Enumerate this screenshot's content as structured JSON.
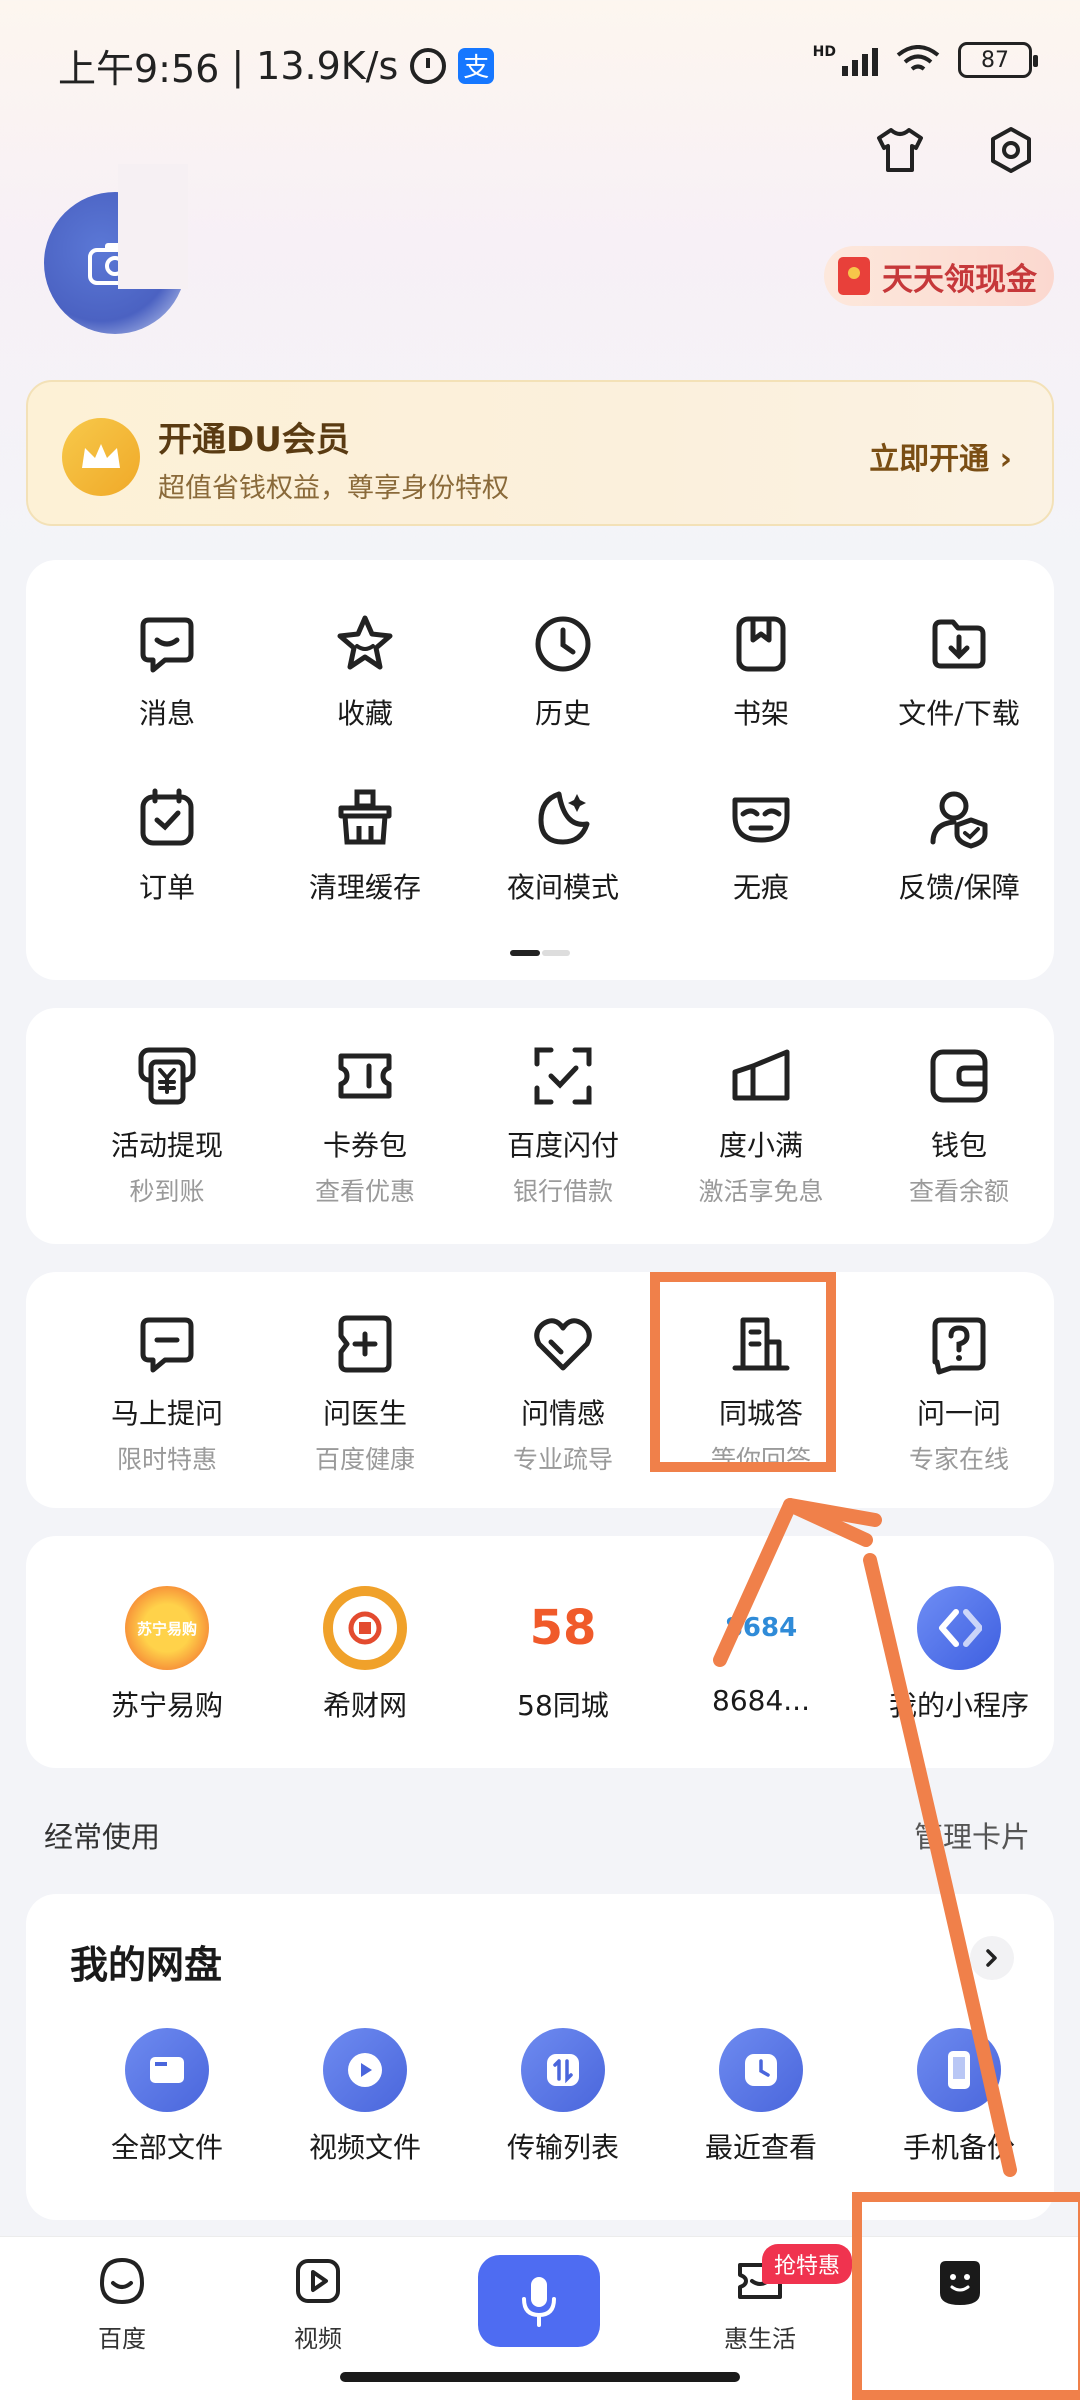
{
  "status_bar": {
    "time": "上午9:56",
    "speed": "13.9K/s",
    "battery": "87",
    "network": "HD",
    "alipay_glyph": "支"
  },
  "header": {
    "icons": [
      "shirt-icon",
      "gear-icon"
    ],
    "cash_pill_label": "天天领现金"
  },
  "vip": {
    "title": "开通DU会员",
    "subtitle": "超值省钱权益，尊享身份特权",
    "action": "立即开通 ›"
  },
  "quick_tools": [
    {
      "label": "消息",
      "icon": "message-icon"
    },
    {
      "label": "收藏",
      "icon": "star-icon"
    },
    {
      "label": "历史",
      "icon": "clock-icon"
    },
    {
      "label": "书架",
      "icon": "bookmark-icon"
    },
    {
      "label": "文件/下载",
      "icon": "download-icon"
    },
    {
      "label": "订单",
      "icon": "order-icon"
    },
    {
      "label": "清理缓存",
      "icon": "clean-icon"
    },
    {
      "label": "夜间模式",
      "icon": "moon-icon"
    },
    {
      "label": "无痕",
      "icon": "mask-icon"
    },
    {
      "label": "反馈/保障",
      "icon": "feedback-icon"
    }
  ],
  "finance": [
    {
      "label": "活动提现",
      "sub": "秒到账",
      "icon": "yuan-icon"
    },
    {
      "label": "卡券包",
      "sub": "查看优惠",
      "icon": "ticket-icon"
    },
    {
      "label": "百度闪付",
      "sub": "银行借款",
      "icon": "scan-check-icon"
    },
    {
      "label": "度小满",
      "sub": "激活享免息",
      "icon": "duxiaoman-icon"
    },
    {
      "label": "钱包",
      "sub": "查看余额",
      "icon": "wallet-icon"
    }
  ],
  "ask": [
    {
      "label": "马上提问",
      "sub": "限时特惠",
      "icon": "ask-icon"
    },
    {
      "label": "问医生",
      "sub": "百度健康",
      "icon": "doctor-icon"
    },
    {
      "label": "问情感",
      "sub": "专业疏导",
      "icon": "heart-icon"
    },
    {
      "label": "同城答",
      "sub": "等你回答",
      "icon": "building-icon"
    },
    {
      "label": "问一问",
      "sub": "专家在线",
      "icon": "question-icon"
    }
  ],
  "mini_apps": [
    {
      "label": "苏宁易购",
      "icon": "suning-logo",
      "logo_text": "苏宁易购"
    },
    {
      "label": "希财网",
      "icon": "xicai-logo"
    },
    {
      "label": "58同城",
      "icon": "58-logo",
      "logo_text": "58"
    },
    {
      "label": "8684...",
      "icon": "8684-logo",
      "logo_text": "8684"
    },
    {
      "label": "我的小程序",
      "icon": "mini-program-logo"
    }
  ],
  "frequent": {
    "title": "经常使用",
    "manage": "管理卡片"
  },
  "netdisk": {
    "title": "我的网盘",
    "items": [
      {
        "label": "全部文件",
        "icon": "folder-icon"
      },
      {
        "label": "视频文件",
        "icon": "video-file-icon"
      },
      {
        "label": "传输列表",
        "icon": "transfer-icon"
      },
      {
        "label": "最近查看",
        "icon": "recent-icon"
      },
      {
        "label": "手机备份",
        "icon": "phone-backup-icon"
      }
    ]
  },
  "bottom_nav": {
    "items": [
      {
        "label": "百度",
        "icon": "baidu-icon"
      },
      {
        "label": "视频",
        "icon": "video-icon"
      },
      {
        "label": "",
        "icon": "mic-icon"
      },
      {
        "label": "惠生活",
        "icon": "life-icon"
      },
      {
        "label": "",
        "icon": "me-icon"
      }
    ],
    "promo_badge": "抢特惠"
  },
  "colors": {
    "accent": "#4e6cf2",
    "annotation": "#f0804a",
    "promo": "#f0334f"
  }
}
